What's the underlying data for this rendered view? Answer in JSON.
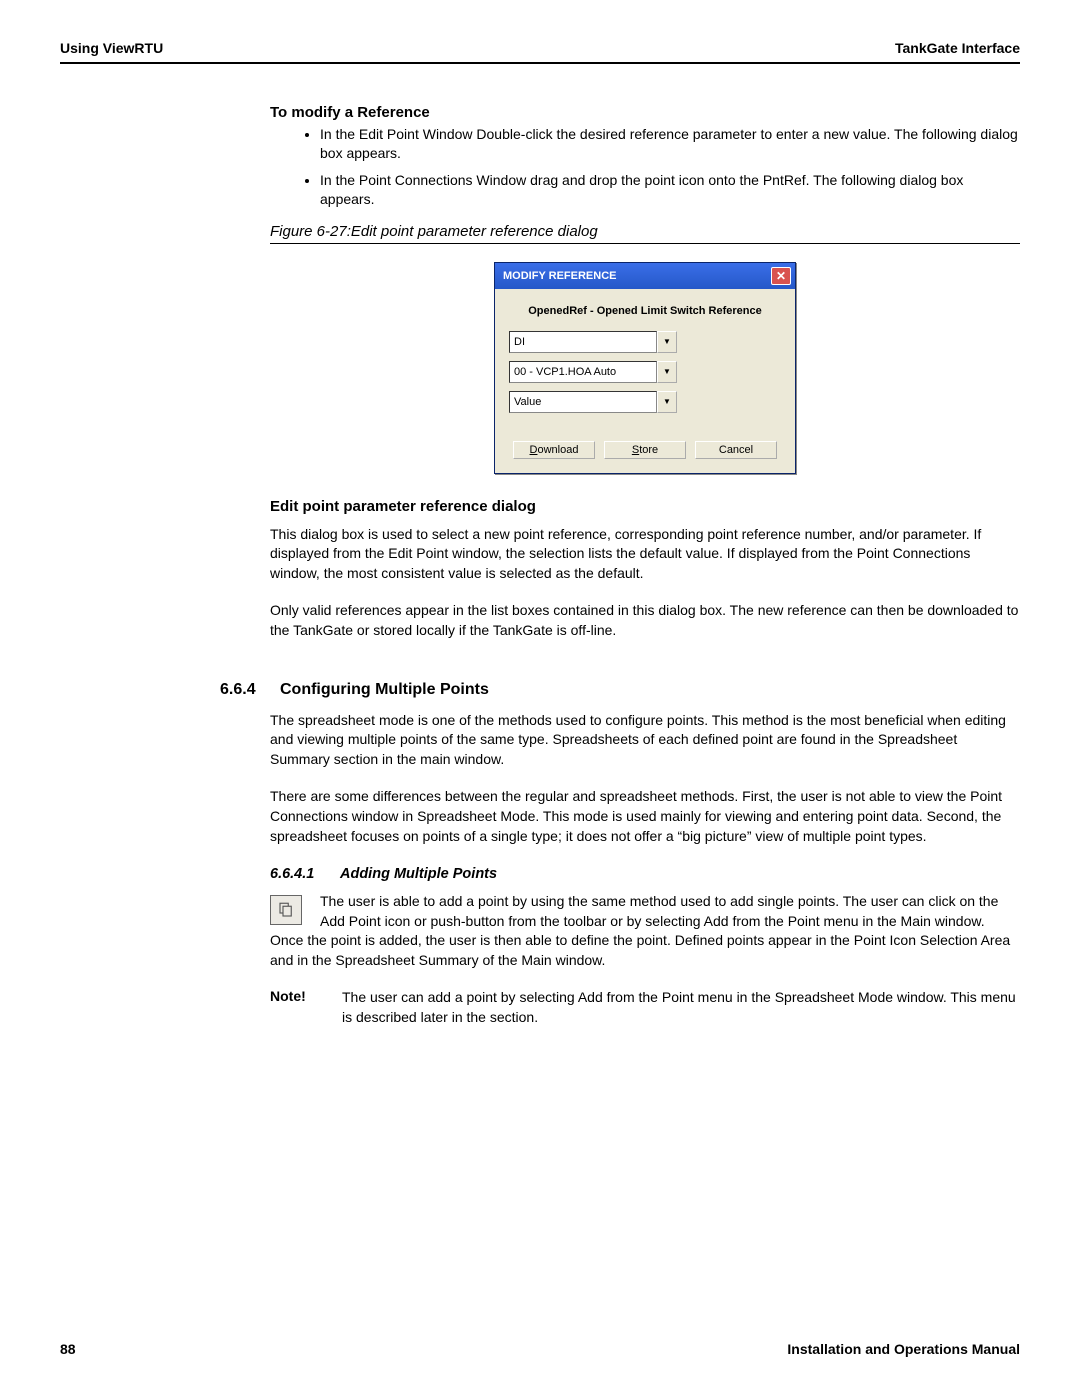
{
  "header": {
    "left": "Using ViewRTU",
    "right": "TankGate Interface"
  },
  "modify_heading": "To modify a Reference",
  "bullets": [
    "In the Edit Point Window Double-click the desired reference parameter to enter a new value. The following dialog box appears.",
    "In the Point Connections Window drag and drop the point icon onto the PntRef. The following dialog box appears."
  ],
  "figure_caption": "Figure 6-27:Edit point parameter reference dialog",
  "dialog": {
    "title": "MODIFY REFERENCE",
    "label": "OpenedRef - Opened Limit Switch Reference",
    "combo1": "DI",
    "combo2": "00 - VCP1.HOA Auto",
    "combo3": "Value",
    "btn_download_pre": "D",
    "btn_download_rest": "ownload",
    "btn_store_pre": "S",
    "btn_store_rest": "tore",
    "btn_cancel": "Cancel"
  },
  "subhead": "Edit point parameter reference dialog",
  "para1": "This dialog box is used to select a new point reference, corresponding point reference number, and/or parameter. If displayed from the Edit Point window, the selection lists the default value. If displayed from the Point Connections window, the most consistent value is selected as the default.",
  "para2": "Only valid references appear in the list boxes contained in this dialog box. The new reference can then be downloaded to the TankGate or stored locally if the TankGate is off-line.",
  "section": {
    "num": "6.6.4",
    "title": "Configuring Multiple Points"
  },
  "para3": "The spreadsheet mode is one of the methods used to configure points. This method is the most beneficial when editing and viewing multiple points of the same type. Spreadsheets of each defined point are found in the Spreadsheet Summary section in the main window.",
  "para4": "There are some differences between the regular and spreadsheet methods. First, the user is not able to view the Point Connections window in Spreadsheet Mode. This mode is used mainly for viewing and entering point data. Second, the spreadsheet focuses on points of a single type; it does not offer a “big picture” view of multiple point types.",
  "subsection": {
    "num": "6.6.4.1",
    "title": "Adding Multiple Points"
  },
  "para5": "The user is able to add a point by using the same method used to add single points. The user can click on the Add Point icon or push-button from the toolbar or by selecting Add from the Point menu in the Main window. Once the point is added, the user is then able to define the point. Defined points appear in the Point Icon Selection Area and in the Spreadsheet Summary of the Main window.",
  "note": {
    "label": "Note!",
    "text": "The user can add a point by selecting Add from the Point menu in the Spreadsheet Mode window. This menu is described later in the section."
  },
  "footer": {
    "page": "88",
    "right": "Installation and Operations Manual"
  }
}
